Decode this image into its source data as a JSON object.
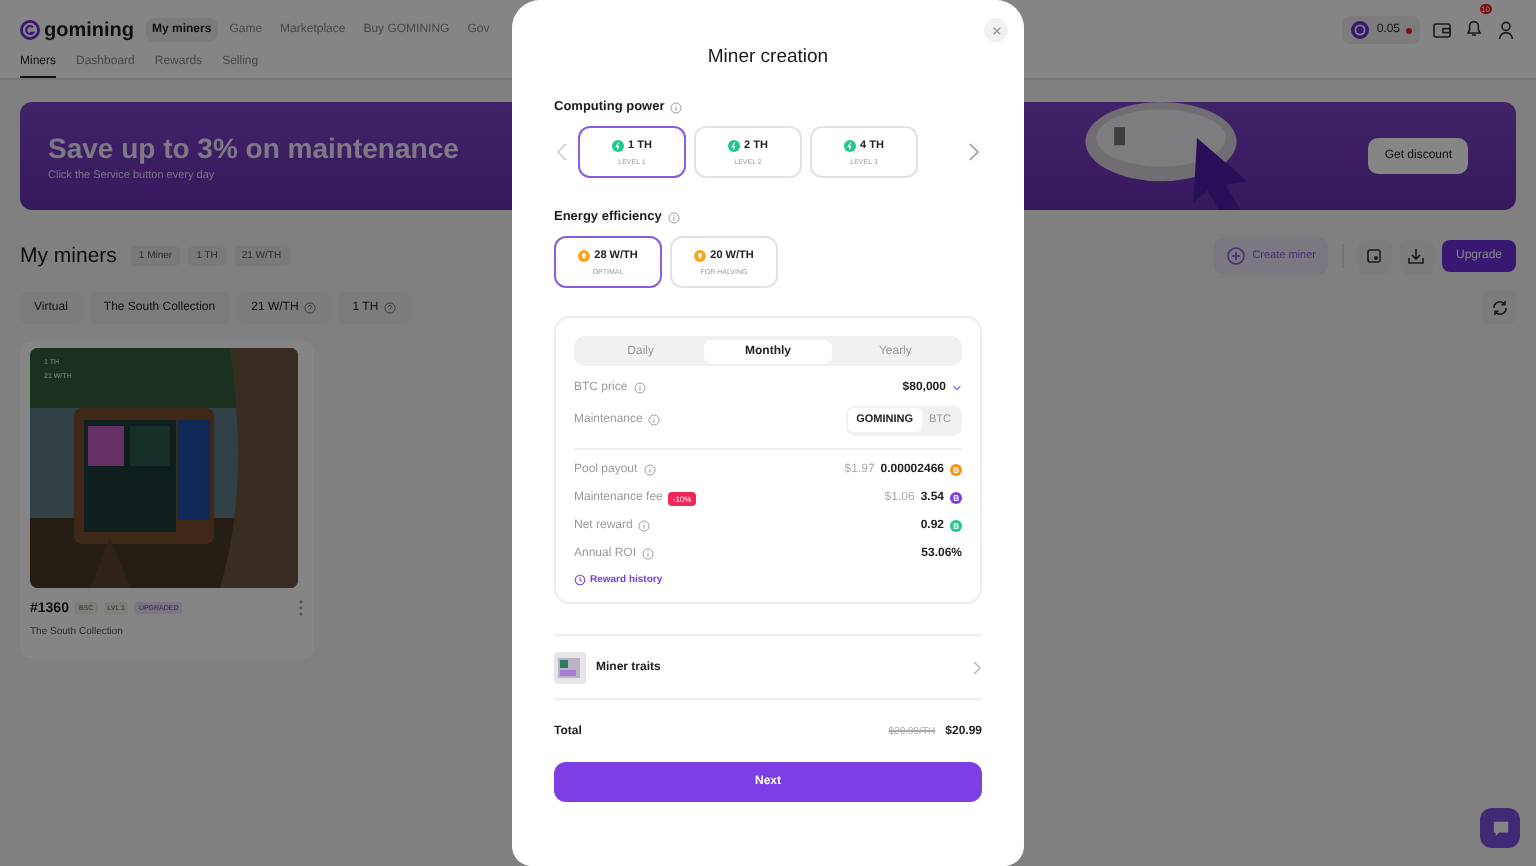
{
  "header": {
    "logo": "gomining",
    "nav": [
      {
        "label": "My miners",
        "selected": true
      },
      {
        "label": "Game",
        "selected": false
      },
      {
        "label": "Marketplace",
        "selected": false
      },
      {
        "label": "Buy GOMINING",
        "selected": false
      },
      {
        "label": "Gov",
        "selected": false
      }
    ],
    "balance": "0.05",
    "notifications": "10"
  },
  "tabs": [
    {
      "label": "Miners",
      "selected": true
    },
    {
      "label": "Dashboard",
      "selected": false
    },
    {
      "label": "Rewards",
      "selected": false
    },
    {
      "label": "Selling",
      "selected": false
    }
  ],
  "banner": {
    "title": "Save up to 3% on maintenance",
    "subtitle": "Click the Service button every day",
    "button": "Get discount"
  },
  "miners": {
    "title": "My miners",
    "stats": [
      "1 Miner",
      "1 TH",
      "21 W/TH"
    ],
    "create": "Create miner",
    "upgrade": "Upgrade",
    "filters": [
      {
        "label": "Virtual",
        "help": false
      },
      {
        "label": "The South Collection",
        "help": false
      },
      {
        "label": "21 W/TH",
        "help": true
      },
      {
        "label": "1 TH",
        "help": true
      }
    ],
    "card": {
      "overlay": [
        "1 TH",
        "21 W/TH"
      ],
      "id": "#1360",
      "badges": [
        "BSC",
        "LVL 1",
        "UPGRADED"
      ],
      "collection": "The South Collection"
    }
  },
  "modal": {
    "title": "Miner creation",
    "power": {
      "label": "Computing power",
      "options": [
        {
          "value": "1 TH",
          "level": "LEVEL 1",
          "selected": true
        },
        {
          "value": "2 TH",
          "level": "LEVEL 2",
          "selected": false
        },
        {
          "value": "4 TH",
          "level": "LEVEL 3",
          "selected": false
        }
      ]
    },
    "efficiency": {
      "label": "Energy efficiency",
      "options": [
        {
          "value": "28 W/TH",
          "note": "OPTIMAL",
          "selected": true
        },
        {
          "value": "20 W/TH",
          "note": "FOR HALVING",
          "selected": false
        }
      ]
    },
    "periods": [
      {
        "label": "Daily",
        "selected": false
      },
      {
        "label": "Monthly",
        "selected": true
      },
      {
        "label": "Yearly",
        "selected": false
      }
    ],
    "btc_price": {
      "label": "BTC price",
      "value": "$80,000"
    },
    "maintenance": {
      "label": "Maintenance",
      "options": [
        {
          "label": "GOMINING",
          "selected": true
        },
        {
          "label": "BTC",
          "selected": false
        }
      ]
    },
    "results": [
      {
        "label": "Pool payout",
        "usd": "$1.97",
        "value": "0.00002466",
        "color": "#f7931a"
      },
      {
        "label": "Maintenance fee",
        "badge": "-10%",
        "usd": "$1.06",
        "value": "3.54",
        "color": "#7b3fe4"
      },
      {
        "label": "Net reward",
        "value": "0.92",
        "color": "#1fc88a"
      },
      {
        "label": "Annual ROI",
        "value": "53.06%"
      }
    ],
    "history": "Reward history",
    "traits": "Miner traits",
    "total": {
      "label": "Total",
      "per_th": "$20.99/TH",
      "value": "$20.99"
    },
    "next": "Next"
  }
}
